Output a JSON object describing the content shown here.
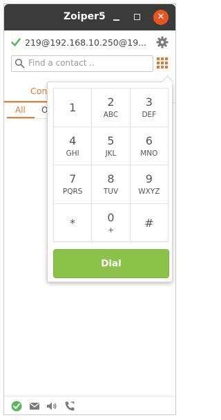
{
  "window": {
    "title": "Zoiper5"
  },
  "titlebar": {
    "minimize_symbol": "",
    "close_symbol": "✕"
  },
  "account": {
    "address": "219@192.168.10.250@19..."
  },
  "search": {
    "placeholder": "Find a contact .."
  },
  "tabs": {
    "main_label": "Cont",
    "sub_all": "All",
    "sub_other": "O"
  },
  "dialpad": {
    "keys": [
      {
        "digit": "1",
        "letters": ""
      },
      {
        "digit": "2",
        "letters": "ABC"
      },
      {
        "digit": "3",
        "letters": "DEF"
      },
      {
        "digit": "4",
        "letters": "GHI"
      },
      {
        "digit": "5",
        "letters": "JKL"
      },
      {
        "digit": "6",
        "letters": "MNO"
      },
      {
        "digit": "7",
        "letters": "PQRS"
      },
      {
        "digit": "8",
        "letters": "TUV"
      },
      {
        "digit": "9",
        "letters": "WXYZ"
      },
      {
        "digit": "*",
        "letters": ""
      },
      {
        "digit": "0",
        "letters": "+"
      },
      {
        "digit": "#",
        "letters": ""
      }
    ],
    "dial_label": "Dial"
  },
  "status_icons": [
    "status-ok-icon",
    "messages-icon",
    "volume-icon",
    "call-log-icon"
  ],
  "colors": {
    "accent_orange": "#e8772e",
    "dial_green": "#8bc34a",
    "status_green": "#5cb85c",
    "titlebar": "#3b3b3b",
    "close_red": "#e95420"
  }
}
